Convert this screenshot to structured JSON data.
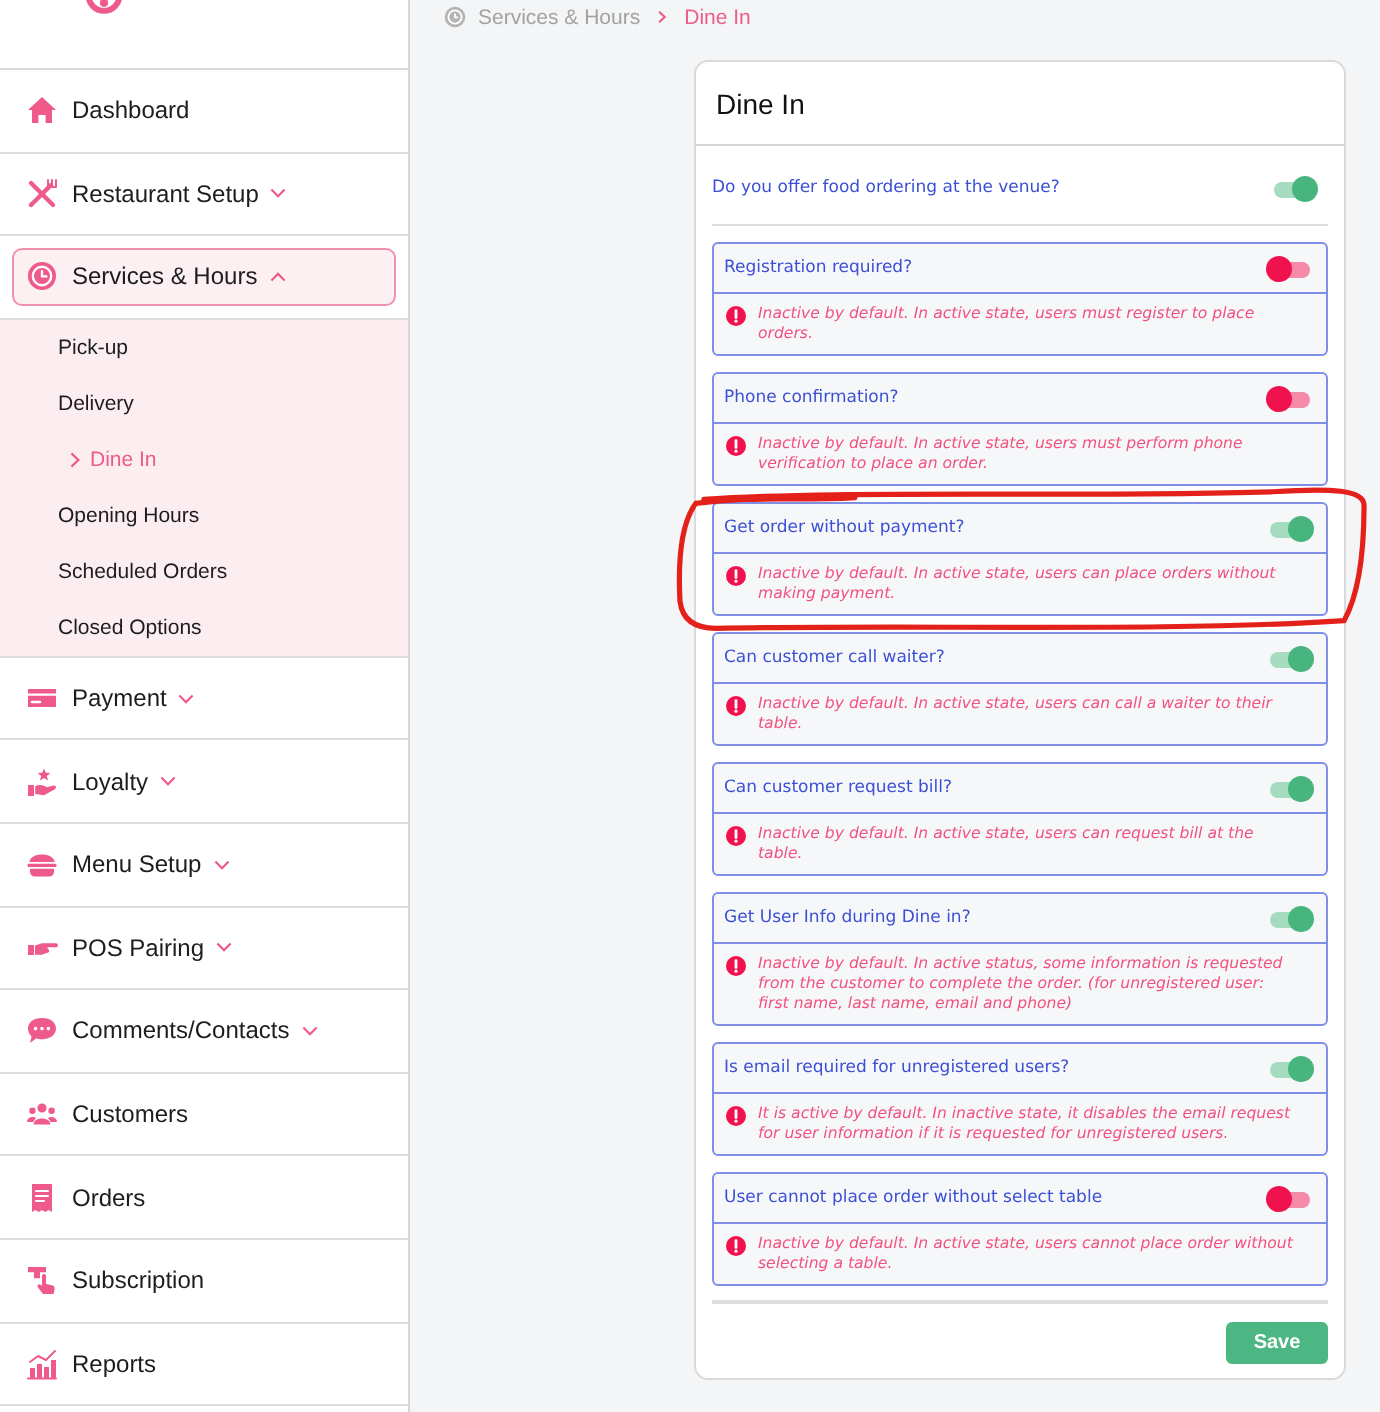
{
  "sidebar": {
    "items": [
      {
        "label": "Dashboard",
        "kind": "link",
        "selected": false
      },
      {
        "label": "Restaurant Setup",
        "kind": "group",
        "expanded": false,
        "selected": false
      },
      {
        "label": "Services & Hours",
        "kind": "group",
        "expanded": true,
        "selected": true,
        "children": [
          {
            "label": "Pick-up",
            "selected": false
          },
          {
            "label": "Delivery",
            "selected": false
          },
          {
            "label": "Dine In",
            "selected": true
          },
          {
            "label": "Opening Hours",
            "selected": false
          },
          {
            "label": "Scheduled Orders",
            "selected": false
          },
          {
            "label": "Closed Options",
            "selected": false
          }
        ]
      },
      {
        "label": "Payment",
        "kind": "group",
        "expanded": false,
        "selected": false
      },
      {
        "label": "Loyalty",
        "kind": "group",
        "expanded": false,
        "selected": false
      },
      {
        "label": "Menu Setup",
        "kind": "group",
        "expanded": false,
        "selected": false
      },
      {
        "label": "POS Pairing",
        "kind": "group",
        "expanded": false,
        "selected": false
      },
      {
        "label": "Comments/Contacts",
        "kind": "group",
        "expanded": false,
        "selected": false
      },
      {
        "label": "Customers",
        "kind": "link",
        "selected": false
      },
      {
        "label": "Orders",
        "kind": "link",
        "selected": false
      },
      {
        "label": "Subscription",
        "kind": "link",
        "selected": false
      },
      {
        "label": "Reports",
        "kind": "link",
        "selected": false
      }
    ]
  },
  "breadcrumb": [
    {
      "label": "Services & Hours",
      "current": false
    },
    {
      "label": "Dine In",
      "current": true
    }
  ],
  "card": {
    "title": "Dine In",
    "main_setting": {
      "label": "Do you offer food ordering at the venue?",
      "on": true
    },
    "settings": [
      {
        "label": "Registration required?",
        "on": false,
        "highlighted": false,
        "note": "Inactive by default. In active state, users must register to place orders."
      },
      {
        "label": "Phone confirmation?",
        "on": false,
        "highlighted": false,
        "note": "Inactive by default. In active state, users must perform phone verification to place an order."
      },
      {
        "label": "Get order without payment?",
        "on": true,
        "highlighted": true,
        "note": "Inactive by default. In active state, users can place orders without making payment."
      },
      {
        "label": "Can customer call waiter?",
        "on": true,
        "highlighted": false,
        "note": "Inactive by default. In active state, users can call a waiter to their table."
      },
      {
        "label": "Can customer request bill?",
        "on": true,
        "highlighted": false,
        "note": "Inactive by default. In active state, users can request bill at the table."
      },
      {
        "label": "Get User Info during Dine in?",
        "on": true,
        "highlighted": false,
        "note": "Inactive by default. In active status, some information is requested from the customer to complete the order. (for unregistered user: first name, last name, email and phone)"
      },
      {
        "label": "Is email required for unregistered users?",
        "on": true,
        "highlighted": false,
        "note": "It is active by default. In inactive state, it disables the email request for user information if it is requested for unregistered users."
      },
      {
        "label": "User cannot place order without select table",
        "on": false,
        "highlighted": false,
        "note": "Inactive by default. In active state, users cannot place order without selecting a table."
      }
    ],
    "save_button": "Save"
  }
}
